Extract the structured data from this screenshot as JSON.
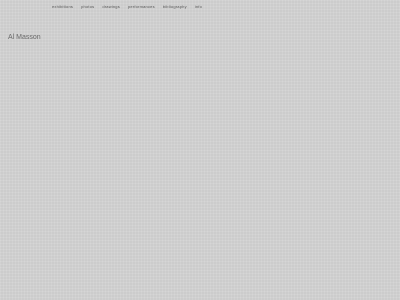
{
  "nav": {
    "items": [
      {
        "label": "exhibitions"
      },
      {
        "label": "photos"
      },
      {
        "label": "drawings"
      },
      {
        "label": "performances"
      },
      {
        "label": "bibliography"
      },
      {
        "label": "info"
      }
    ]
  },
  "site": {
    "title": "Al Masson"
  }
}
